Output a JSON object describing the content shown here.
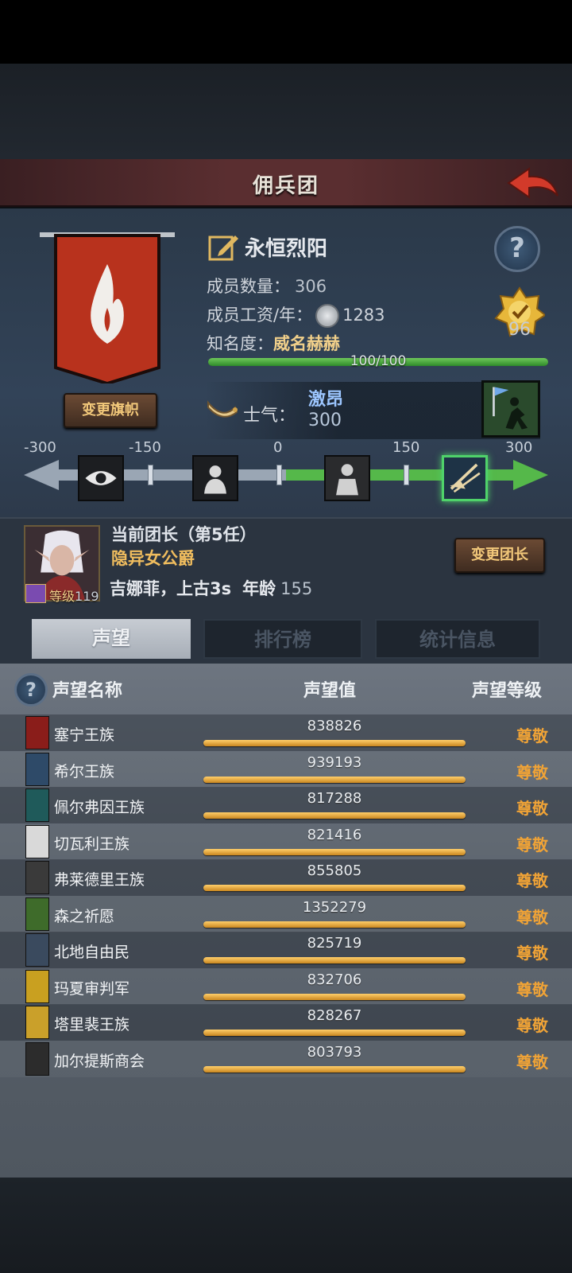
{
  "header": {
    "title": "佣兵团"
  },
  "guild": {
    "name": "永恒烈阳",
    "members_label": "成员数量：",
    "members_value": "306",
    "salary_label": "成员工资/年：",
    "salary_value": "1283",
    "fame_label": "知名度：",
    "fame_level": "威名赫赫",
    "fame_progress_text": "100/100",
    "fame_progress": 1.0,
    "medal_value": "96",
    "change_banner_label": "变更旗帜",
    "banner_color": "#b8321d"
  },
  "morale": {
    "label": "士气：",
    "state": "激昂",
    "value": "300",
    "scale_ticks": [
      "-300",
      "-150",
      "0",
      "150",
      "300"
    ]
  },
  "leader": {
    "title_line": "当前团长（第5任）",
    "rank_title": "隐异女公爵",
    "name_line": "吉娜菲，上古3s",
    "age_label": "年龄",
    "age_value": "155",
    "level_label": "等级",
    "level_value": "119",
    "change_leader_label": "变更团长"
  },
  "tabs": [
    {
      "label": "声望",
      "active": true
    },
    {
      "label": "排行榜",
      "active": false
    },
    {
      "label": "统计信息",
      "active": false
    }
  ],
  "reputation": {
    "col_name": "声望名称",
    "col_value": "声望值",
    "col_level": "声望等级",
    "rows": [
      {
        "name": "塞宁王族",
        "value": "838826",
        "level": "尊敬",
        "crest_color": "#8a1d1a"
      },
      {
        "name": "希尔王族",
        "value": "939193",
        "level": "尊敬",
        "crest_color": "#2e4a68"
      },
      {
        "name": "佩尔弗因王族",
        "value": "817288",
        "level": "尊敬",
        "crest_color": "#1f5a5a"
      },
      {
        "name": "切瓦利王族",
        "value": "821416",
        "level": "尊敬",
        "crest_color": "#d9d9d9"
      },
      {
        "name": "弗莱德里王族",
        "value": "855805",
        "level": "尊敬",
        "crest_color": "#3a3a3a"
      },
      {
        "name": "森之祈愿",
        "value": "1352279",
        "level": "尊敬",
        "crest_color": "#3e6b2a"
      },
      {
        "name": "北地自由民",
        "value": "825719",
        "level": "尊敬",
        "crest_color": "#3a4a5e"
      },
      {
        "name": "玛夏审判军",
        "value": "832706",
        "level": "尊敬",
        "crest_color": "#c9a020"
      },
      {
        "name": "塔里裴王族",
        "value": "828267",
        "level": "尊敬",
        "crest_color": "#caa02a"
      },
      {
        "name": "加尔提斯商会",
        "value": "803793",
        "level": "尊敬",
        "crest_color": "#2c2c2c"
      }
    ]
  }
}
